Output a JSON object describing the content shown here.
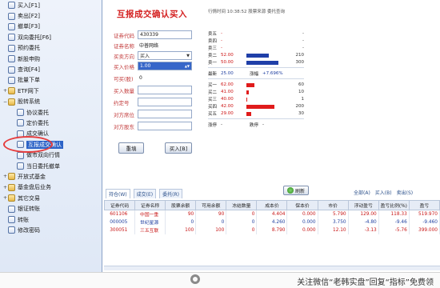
{
  "sidebar": {
    "items": [
      {
        "label": "买入[F1]",
        "icon": "doc",
        "level": 1
      },
      {
        "label": "卖出[F2]",
        "icon": "doc",
        "level": 1
      },
      {
        "label": "撤单[F3]",
        "icon": "doc",
        "level": 1
      },
      {
        "label": "双向委托[F6]",
        "icon": "doc",
        "level": 1
      },
      {
        "label": "预约委托",
        "icon": "doc",
        "level": 1
      },
      {
        "label": "新股申购",
        "icon": "doc",
        "level": 1
      },
      {
        "label": "查询[F4]",
        "icon": "doc",
        "level": 1
      },
      {
        "label": "批量下单",
        "icon": "doc",
        "level": 1
      },
      {
        "label": "ETF网下",
        "icon": "folder",
        "level": 1
      },
      {
        "label": "股转系统",
        "icon": "folder",
        "level": 1,
        "expanded": true
      },
      {
        "label": "协议委托",
        "icon": "doc",
        "level": 2
      },
      {
        "label": "定价委托",
        "icon": "doc",
        "level": 2
      },
      {
        "label": "成交确认",
        "icon": "doc",
        "level": 2
      },
      {
        "label": "互报成交确认",
        "icon": "doc",
        "level": 2,
        "selected": true
      },
      {
        "label": "做市双向行情",
        "icon": "doc",
        "level": 2
      },
      {
        "label": "当日委托撤单",
        "icon": "doc",
        "level": 2
      },
      {
        "label": "开放式基金",
        "icon": "folder",
        "level": 1
      },
      {
        "label": "基金盘后业务",
        "icon": "folder",
        "level": 1
      },
      {
        "label": "其它交易",
        "icon": "folder",
        "level": 1
      },
      {
        "label": "银证转账",
        "icon": "doc",
        "level": 1
      },
      {
        "label": "转账",
        "icon": "doc",
        "level": 1
      },
      {
        "label": "修改密码",
        "icon": "doc",
        "level": 1
      }
    ]
  },
  "order_form": {
    "title": "互报成交确认买入",
    "fields": [
      {
        "label": "证券代码",
        "value": "430339",
        "kind": "box"
      },
      {
        "label": "证券名称",
        "value": "中普网络",
        "kind": "plain"
      },
      {
        "label": "买卖方向",
        "value": "买入",
        "kind": "select"
      },
      {
        "label": "买入价格",
        "value": "1.00",
        "kind": "selected"
      },
      {
        "label": "可买(股)",
        "value": "0",
        "kind": "plain"
      },
      {
        "label": "买入数量",
        "value": "",
        "kind": "box"
      },
      {
        "label": "约定号",
        "value": "",
        "kind": "box"
      },
      {
        "label": "对方席位",
        "value": "",
        "kind": "box"
      },
      {
        "label": "对方股东",
        "value": "",
        "kind": "box"
      }
    ],
    "reset_label": "重填",
    "submit_label": "买入[B]"
  },
  "quote": {
    "header": "行情时间  10:38:52  股票来源  委托查询",
    "sell_rows": [
      {
        "label": "卖五",
        "price": "-",
        "vol": "-",
        "bar": 0
      },
      {
        "label": "卖四",
        "price": "-",
        "vol": "-",
        "bar": 0
      },
      {
        "label": "卖三",
        "price": "-",
        "vol": "-",
        "bar": 0
      },
      {
        "label": "卖二",
        "price": "52.00",
        "vol": "210",
        "bar": 0.55
      },
      {
        "label": "卖一",
        "price": "50.00",
        "vol": "300",
        "bar": 0.8
      }
    ],
    "latest": {
      "label": "最新",
      "price": "25.00",
      "change_label": "涨幅",
      "change": "+7.696%"
    },
    "buy_rows": [
      {
        "label": "买一",
        "price": "62.00",
        "vol": "60",
        "bar": 0.2
      },
      {
        "label": "买二",
        "price": "41.00",
        "vol": "10",
        "bar": 0.05
      },
      {
        "label": "买三",
        "price": "40.00",
        "vol": "1",
        "bar": 0.02
      },
      {
        "label": "买四",
        "price": "42.00",
        "vol": "200",
        "bar": 0.7
      },
      {
        "label": "买五",
        "price": "29.00",
        "vol": "30",
        "bar": 0.12
      }
    ],
    "footer": {
      "label1": "涨停",
      "value1": "-",
      "label2": "跌停",
      "value2": "-"
    }
  },
  "bottom": {
    "tabs": [
      "持仓(W)",
      "成交(E)",
      "委托(R)"
    ],
    "refresh_label": "刷新",
    "right_tools": [
      "全部(A)",
      "买入(B)",
      "卖出(S)"
    ],
    "columns": [
      "证券代码",
      "证券名称",
      "股票余额",
      "可用余额",
      "冻结数量",
      "成本价",
      "保本价",
      "市价",
      "浮动盈亏",
      "盈亏比例(%)",
      "盈亏"
    ],
    "rows": [
      [
        "601106",
        "中国一重",
        "90",
        "90",
        "0",
        "4.404",
        "0.000",
        "5.790",
        "129.00",
        "118.33",
        "519.970"
      ],
      [
        "000005",
        "世纪星源",
        "0",
        "0",
        "0",
        "4.260",
        "0.000",
        "3.750",
        "-4.80",
        "-9.46",
        "-9.460"
      ],
      [
        "300051",
        "三五互联",
        "100",
        "100",
        "0",
        "8.790",
        "0.000",
        "12.10",
        "-3.13",
        "-5.76",
        "399.000"
      ]
    ]
  },
  "watermark": {
    "text": "关注微信“老韩实盘”回复“指标”免费领"
  },
  "colors": {
    "accent_red": "#d42020",
    "sell_bar": "#1f3fa8",
    "buy_bar": "#e01b1b",
    "selection": "#2c63c7"
  }
}
